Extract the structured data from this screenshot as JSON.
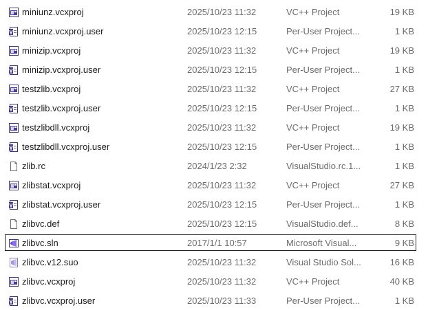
{
  "files": [
    {
      "name": "miniunz.vcxproj",
      "date": "2025/10/23 11:32",
      "type": "VC++ Project",
      "size": "19 KB",
      "icon": "vcxproj-icon",
      "selected": false
    },
    {
      "name": "miniunz.vcxproj.user",
      "date": "2025/10/23 12:15",
      "type": "Per-User Project...",
      "size": "1 KB",
      "icon": "vcxproj-user-icon",
      "selected": false
    },
    {
      "name": "minizip.vcxproj",
      "date": "2025/10/23 11:32",
      "type": "VC++ Project",
      "size": "19 KB",
      "icon": "vcxproj-icon",
      "selected": false
    },
    {
      "name": "minizip.vcxproj.user",
      "date": "2025/10/23 12:15",
      "type": "Per-User Project...",
      "size": "1 KB",
      "icon": "vcxproj-user-icon",
      "selected": false
    },
    {
      "name": "testzlib.vcxproj",
      "date": "2025/10/23 11:32",
      "type": "VC++ Project",
      "size": "27 KB",
      "icon": "vcxproj-icon",
      "selected": false
    },
    {
      "name": "testzlib.vcxproj.user",
      "date": "2025/10/23 12:15",
      "type": "Per-User Project...",
      "size": "1 KB",
      "icon": "vcxproj-user-icon",
      "selected": false
    },
    {
      "name": "testzlibdll.vcxproj",
      "date": "2025/10/23 11:32",
      "type": "VC++ Project",
      "size": "19 KB",
      "icon": "vcxproj-icon",
      "selected": false
    },
    {
      "name": "testzlibdll.vcxproj.user",
      "date": "2025/10/23 12:15",
      "type": "Per-User Project...",
      "size": "1 KB",
      "icon": "vcxproj-user-icon",
      "selected": false
    },
    {
      "name": "zlib.rc",
      "date": "2024/1/23 2:32",
      "type": "VisualStudio.rc.1...",
      "size": "1 KB",
      "icon": "document-icon",
      "selected": false
    },
    {
      "name": "zlibstat.vcxproj",
      "date": "2025/10/23 11:32",
      "type": "VC++ Project",
      "size": "27 KB",
      "icon": "vcxproj-icon",
      "selected": false
    },
    {
      "name": "zlibstat.vcxproj.user",
      "date": "2025/10/23 12:15",
      "type": "Per-User Project...",
      "size": "1 KB",
      "icon": "vcxproj-user-icon",
      "selected": false
    },
    {
      "name": "zlibvc.def",
      "date": "2025/10/23 12:15",
      "type": "VisualStudio.def...",
      "size": "8 KB",
      "icon": "document-icon",
      "selected": false
    },
    {
      "name": "zlibvc.sln",
      "date": "2017/1/1 10:57",
      "type": "Microsoft Visual...",
      "size": "9 KB",
      "icon": "sln-icon",
      "selected": true
    },
    {
      "name": "zlibvc.v12.suo",
      "date": "2025/10/23 11:32",
      "type": "Visual Studio Sol...",
      "size": "16 KB",
      "icon": "suo-icon",
      "selected": false
    },
    {
      "name": "zlibvc.vcxproj",
      "date": "2025/10/23 11:32",
      "type": "VC++ Project",
      "size": "40 KB",
      "icon": "vcxproj-icon",
      "selected": false
    },
    {
      "name": "zlibvc.vcxproj.user",
      "date": "2025/10/23 11:33",
      "type": "Per-User Project...",
      "size": "1 KB",
      "icon": "vcxproj-user-icon",
      "selected": false
    }
  ],
  "colors": {
    "text": "#1a1a1a",
    "secondary_text": "#6b6b6b",
    "project_icon": "#4a3c8c",
    "selection_border": "#1f1f1f"
  }
}
